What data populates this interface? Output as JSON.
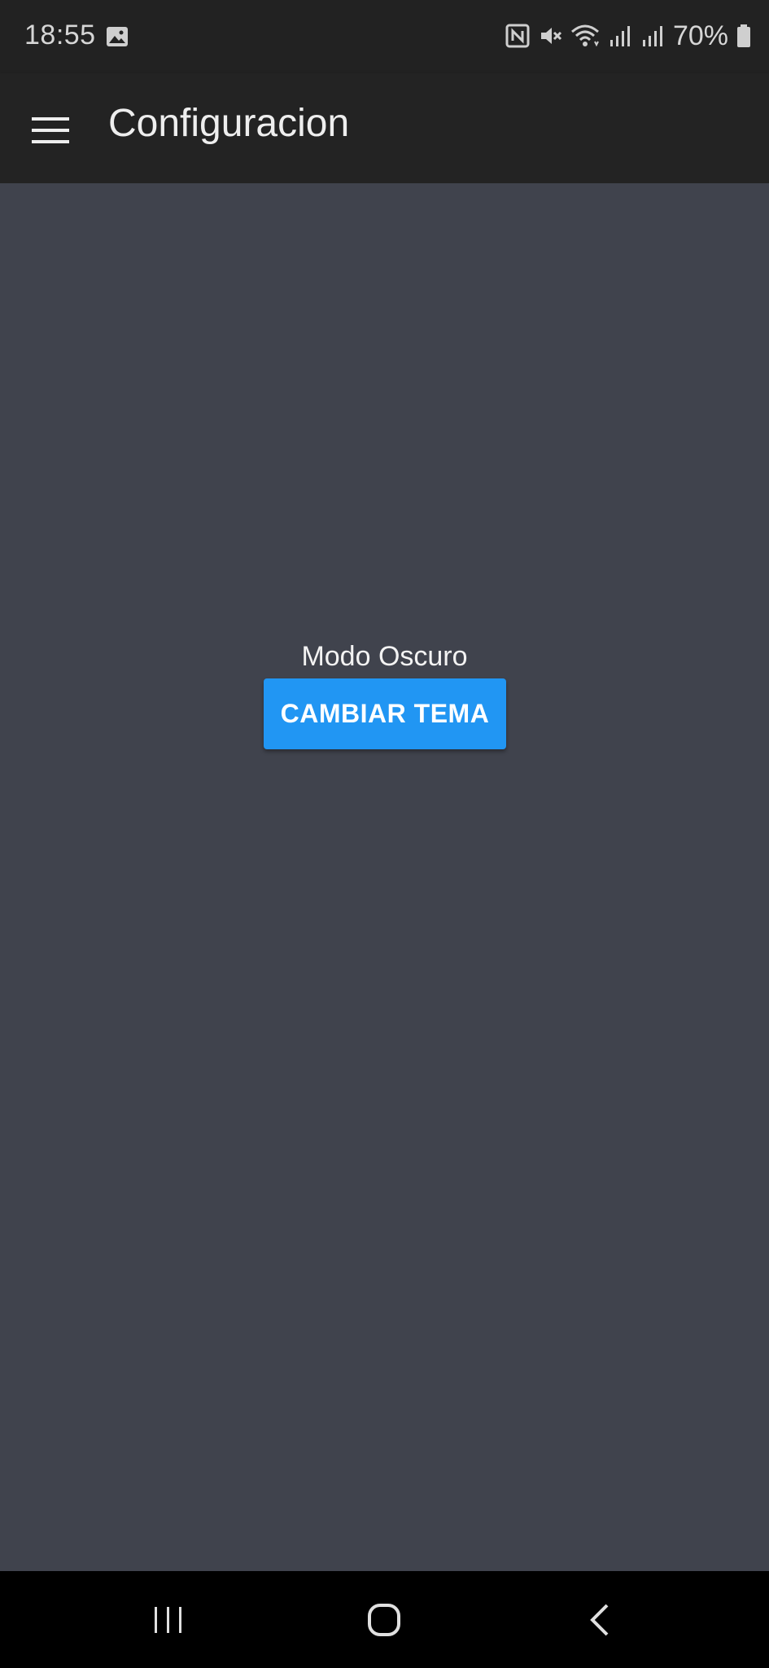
{
  "status_bar": {
    "time": "18:55",
    "battery": "70%",
    "icons": [
      "image-icon",
      "nfc-icon",
      "mute-icon",
      "wifi-icon",
      "signal-icon",
      "signal-icon",
      "battery-icon"
    ]
  },
  "app_bar": {
    "title": "Configuracion",
    "menu_icon": "hamburger-menu-icon"
  },
  "content": {
    "theme_label": "Modo Oscuro",
    "theme_button_label": "CAMBIAR TEMA"
  },
  "nav_bar": {
    "icons": [
      "recent-apps-icon",
      "home-icon",
      "back-icon"
    ]
  },
  "colors": {
    "background": "#40434d",
    "app_bar": "#232323",
    "status_bar": "#222222",
    "accent": "#2196f3",
    "nav_bar": "#000000"
  }
}
